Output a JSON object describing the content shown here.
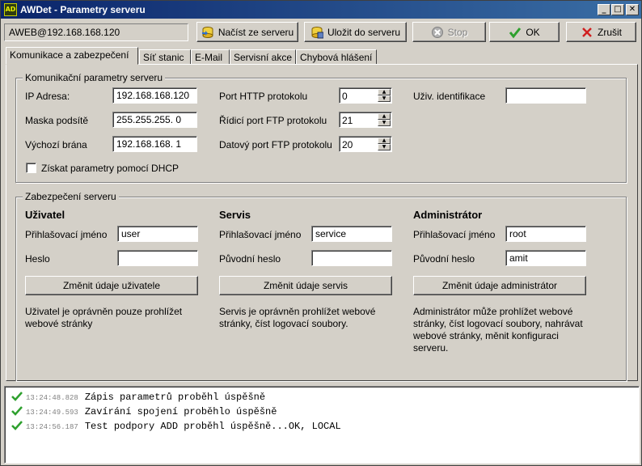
{
  "window": {
    "title": "AWDet - Parametry serveru",
    "app_icon_text": "AD",
    "minimize": "_",
    "maximize": "□",
    "close": "✕"
  },
  "toolbar": {
    "connection": "AWEB@192.168.168.120",
    "load_label": "Načíst ze serveru",
    "save_label": "Uložit do serveru",
    "stop_label": "Stop",
    "ok_label": "OK",
    "cancel_label": "Zrušit"
  },
  "tabs": [
    {
      "label": "Komunikace a zabezpečení",
      "active": true
    },
    {
      "label": "Síť stanic",
      "active": false
    },
    {
      "label": "E-Mail",
      "active": false
    },
    {
      "label": "Servisní akce",
      "active": false
    },
    {
      "label": "Chybová hlášení",
      "active": false
    }
  ],
  "comm": {
    "legend": "Komunikační parametry serveru",
    "ip_label": "IP Adresa:",
    "ip_value": "192.168.168.120",
    "mask_label": "Maska podsítě",
    "mask_value": "255.255.255.  0",
    "gateway_label": "Výchozí brána",
    "gateway_value": "192.168.168.  1",
    "http_port_label": "Port HTTP protokolu",
    "http_port_value": "0",
    "ftp_ctrl_label": "Řídicí port FTP protokolu",
    "ftp_ctrl_value": "21",
    "ftp_data_label": "Datový port FTP protokolu",
    "ftp_data_value": "20",
    "user_id_label": "Uživ. identifikace",
    "user_id_value": "",
    "dhcp_label": "Získat parametry pomocí DHCP",
    "dhcp_checked": false
  },
  "security": {
    "legend": "Zabezpečení serveru",
    "user": {
      "heading": "Uživatel",
      "login_label": "Přihlašovací jméno",
      "login_value": "user",
      "password_label": "Heslo",
      "password_value": "",
      "button": "Změnit údaje uživatele",
      "desc_line1": "Uživatel je oprávněn pouze prohlížet",
      "desc_line2": "webové stránky"
    },
    "service": {
      "heading": "Servis",
      "login_label": "Přihlašovací jméno",
      "login_value": "service",
      "password_label": "Původní heslo",
      "password_value": "",
      "button": "Změnit údaje servis",
      "desc_line1": "Servis je oprávněn prohlížet webové",
      "desc_line2": "stránky, číst logovací soubory."
    },
    "admin": {
      "heading": "Administrátor",
      "login_label": "Přihlašovací jméno",
      "login_value": "root",
      "password_label": "Původní heslo",
      "password_value": "amit",
      "button": "Změnit údaje administrátor",
      "desc_line1": "Administrátor může prohlížet webové",
      "desc_line2": "stránky, číst logovací soubory, nahrávat",
      "desc_line3": "webové stránky, měnit konfiguraci",
      "desc_line4": "serveru."
    }
  },
  "log": [
    {
      "time": "13:24:48.828",
      "message": "Zápis parametrů proběhl úspěšně"
    },
    {
      "time": "13:24:49.593",
      "message": "Zavírání spojení proběhlo úspěšně"
    },
    {
      "time": "13:24:56.187",
      "message": "Test podpory ADD proběhl úspěšně...OK, LOCAL"
    }
  ],
  "colors": {
    "title_start": "#0a246a",
    "title_end": "#3a6ea5",
    "face": "#d4d0c8",
    "ok_green": "#2ea02e",
    "cancel_red": "#d02020"
  }
}
